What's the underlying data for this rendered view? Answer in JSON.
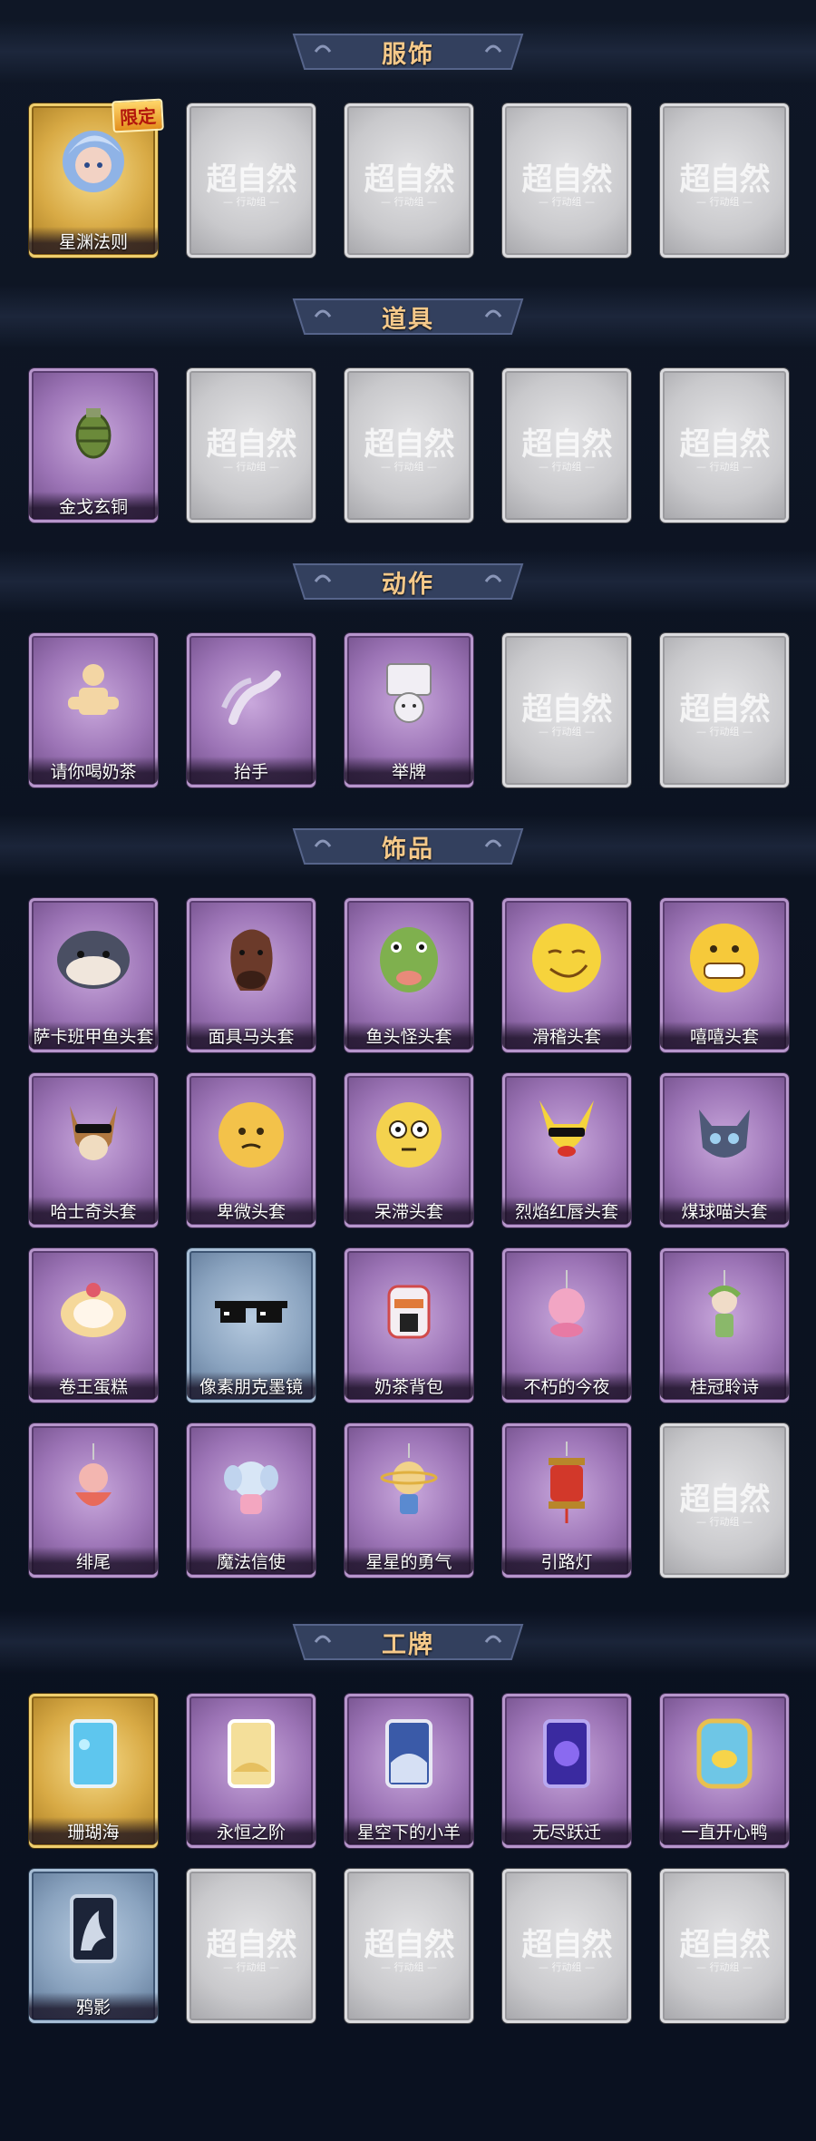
{
  "sections": [
    {
      "title": "服饰",
      "items": [
        {
          "label": "星渊法则",
          "rarity": "gold",
          "icon": "hero-portrait-icon",
          "badge": "限定"
        },
        {
          "label": "",
          "rarity": "empty"
        },
        {
          "label": "",
          "rarity": "empty"
        },
        {
          "label": "",
          "rarity": "empty"
        },
        {
          "label": "",
          "rarity": "empty"
        }
      ]
    },
    {
      "title": "道具",
      "items": [
        {
          "label": "金戈玄铜",
          "rarity": "purple",
          "icon": "grenade-icon"
        },
        {
          "label": "",
          "rarity": "empty"
        },
        {
          "label": "",
          "rarity": "empty"
        },
        {
          "label": "",
          "rarity": "empty"
        },
        {
          "label": "",
          "rarity": "empty"
        }
      ]
    },
    {
      "title": "动作",
      "items": [
        {
          "label": "请你喝奶茶",
          "rarity": "purple",
          "icon": "tea-offer-icon"
        },
        {
          "label": "抬手",
          "rarity": "purple",
          "icon": "raise-hand-icon"
        },
        {
          "label": "举牌",
          "rarity": "purple",
          "icon": "hold-sign-icon"
        },
        {
          "label": "",
          "rarity": "empty"
        },
        {
          "label": "",
          "rarity": "empty"
        }
      ]
    },
    {
      "title": "饰品",
      "items": [
        {
          "label": "萨卡班甲鱼头套",
          "rarity": "purple",
          "icon": "fish-head-icon"
        },
        {
          "label": "面具马头套",
          "rarity": "purple",
          "icon": "horse-head-icon"
        },
        {
          "label": "鱼头怪头套",
          "rarity": "purple",
          "icon": "green-fish-head-icon"
        },
        {
          "label": "滑稽头套",
          "rarity": "purple",
          "icon": "smirk-face-icon"
        },
        {
          "label": "嘻嘻头套",
          "rarity": "purple",
          "icon": "grin-face-icon"
        },
        {
          "label": "哈士奇头套",
          "rarity": "purple",
          "icon": "husky-head-icon"
        },
        {
          "label": "卑微头套",
          "rarity": "purple",
          "icon": "humble-face-icon"
        },
        {
          "label": "呆滞头套",
          "rarity": "purple",
          "icon": "dazed-face-icon"
        },
        {
          "label": "烈焰红唇头套",
          "rarity": "purple",
          "icon": "pikachu-head-icon"
        },
        {
          "label": "煤球喵头套",
          "rarity": "purple",
          "icon": "cat-head-icon"
        },
        {
          "label": "卷王蛋糕",
          "rarity": "purple",
          "icon": "roll-cake-icon"
        },
        {
          "label": "像素朋克墨镜",
          "rarity": "blue",
          "icon": "pixel-sunglasses-icon"
        },
        {
          "label": "奶茶背包",
          "rarity": "purple",
          "icon": "tea-backpack-icon"
        },
        {
          "label": "不朽的今夜",
          "rarity": "purple",
          "icon": "pink-pendant-icon"
        },
        {
          "label": "桂冠聆诗",
          "rarity": "purple",
          "icon": "laurel-pendant-icon"
        },
        {
          "label": "绯尾",
          "rarity": "purple",
          "icon": "fox-pendant-icon"
        },
        {
          "label": "魔法信使",
          "rarity": "purple",
          "icon": "elephant-pendant-icon"
        },
        {
          "label": "星星的勇气",
          "rarity": "purple",
          "icon": "star-pendant-icon"
        },
        {
          "label": "引路灯",
          "rarity": "purple",
          "icon": "lantern-icon"
        },
        {
          "label": "",
          "rarity": "empty"
        }
      ]
    },
    {
      "title": "工牌",
      "items": [
        {
          "label": "珊瑚海",
          "rarity": "gold",
          "icon": "badge-coral-icon"
        },
        {
          "label": "永恒之阶",
          "rarity": "purple",
          "icon": "badge-gold-icon"
        },
        {
          "label": "星空下的小羊",
          "rarity": "purple",
          "icon": "badge-sky-icon"
        },
        {
          "label": "无尽跃迁",
          "rarity": "purple",
          "icon": "badge-galaxy-icon"
        },
        {
          "label": "一直开心鸭",
          "rarity": "purple",
          "icon": "badge-duck-icon"
        },
        {
          "label": "鸦影",
          "rarity": "blue",
          "icon": "badge-shadow-icon"
        },
        {
          "label": "",
          "rarity": "empty"
        },
        {
          "label": "",
          "rarity": "empty"
        },
        {
          "label": "",
          "rarity": "empty"
        },
        {
          "label": "",
          "rarity": "empty"
        }
      ]
    }
  ],
  "placeholder": {
    "logo": "超自然",
    "sub": "— 行动组 —"
  }
}
